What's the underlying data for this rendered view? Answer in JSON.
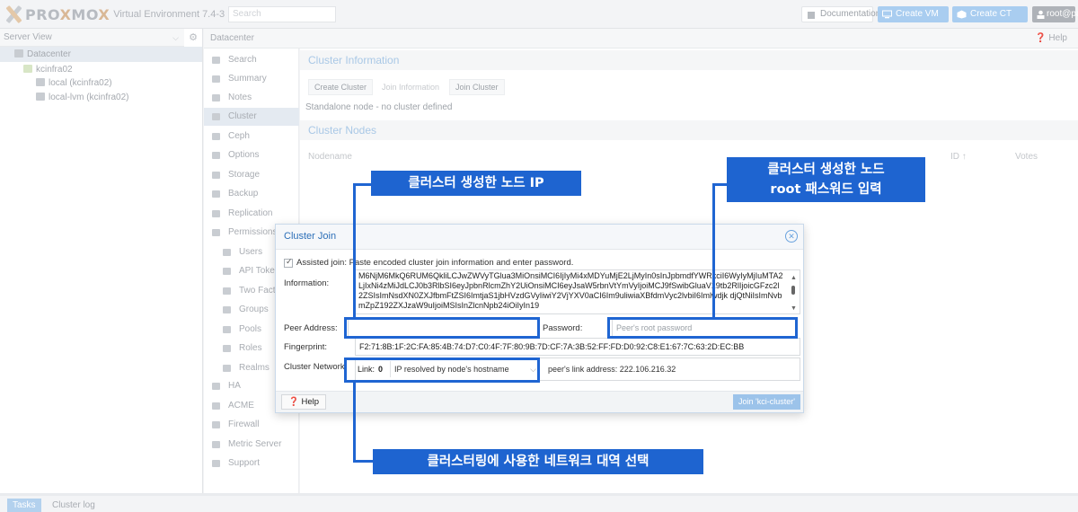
{
  "topbar": {
    "logo_a": "PRO",
    "logo_b": "X",
    "logo_c": "MO",
    "logo_d": "X",
    "subtitle": "Virtual Environment 7.4-3",
    "search_placeholder": "Search",
    "documentation": "Documentation",
    "create_vm": "Create VM",
    "create_ct": "Create CT",
    "user": "root@pam"
  },
  "tree": {
    "view": "Server View",
    "items": [
      {
        "label": "Datacenter"
      },
      {
        "label": "kcinfra02"
      },
      {
        "label": "local (kcinfra02)"
      },
      {
        "label": "local-lvm (kcinfra02)"
      }
    ]
  },
  "breadcrumb": "Datacenter",
  "help_label": "Help",
  "nav": [
    {
      "label": "Search"
    },
    {
      "label": "Summary"
    },
    {
      "label": "Notes"
    },
    {
      "label": "Cluster"
    },
    {
      "label": "Ceph"
    },
    {
      "label": "Options"
    },
    {
      "label": "Storage"
    },
    {
      "label": "Backup"
    },
    {
      "label": "Replication"
    },
    {
      "label": "Permissions"
    },
    {
      "label": "Users"
    },
    {
      "label": "API Tokens"
    },
    {
      "label": "Two Factor"
    },
    {
      "label": "Groups"
    },
    {
      "label": "Pools"
    },
    {
      "label": "Roles"
    },
    {
      "label": "Realms"
    },
    {
      "label": "HA"
    },
    {
      "label": "ACME"
    },
    {
      "label": "Firewall"
    },
    {
      "label": "Metric Server"
    },
    {
      "label": "Support"
    }
  ],
  "cluster": {
    "info_title": "Cluster Information",
    "create_btn": "Create Cluster",
    "join_info_btn": "Join Information",
    "join_btn": "Join Cluster",
    "standalone": "Standalone node - no cluster defined",
    "nodes_title": "Cluster Nodes",
    "col_nodename": "Nodename",
    "col_id": "ID ↑",
    "col_votes": "Votes"
  },
  "dialog": {
    "title": "Cluster Join",
    "assisted": "Assisted join: Paste encoded cluster join information and enter password.",
    "info_label": "Information:",
    "info_value": "M6NjM6MkQ6RUM6QkliLCJwZWVyTGlua3MiOnsiMCI6IjIyMi4xMDYuMjE2LjMyIn0sInJpbmdfYWRkciI6WyIyMjIuMTA2LjIxNi4zMiJdLCJ0b3RlbSI6eyJpbnRlcmZhY2UiOnsiMCI6eyJsaW5rbnVtYmVyIjoiMCJ9fSwibGluaV19tb2RlIjoicGFzc2l2ZSIsImNsdXN0ZXJfbmFtZSI6ImtjaS1jbHVzdGVyIiwiY2VjYXV0aCI6Im9uliwiaXBfdmVyc2lvbiI6Imlwdjk",
    "info_value2": "djQtNiIsImNvbmZpZ192ZXJzaW9uIjoiMSIsInZlcnNpb24iOiIyIn19",
    "peer_label": "Peer Address:",
    "peer_value": "",
    "password_label": "Password:",
    "password_placeholder": "Peer's root password",
    "fingerprint_label": "Fingerprint:",
    "fingerprint": "F2:71:8B:1F:2C:FA:85:4B:74:D7:C0:4F:7F:80:9B:7D:CF:7A:3B:52:FF:FD:D0:92:C8:E1:67:7C:63:2D:EC:BB",
    "network_label": "Cluster Network:",
    "link_label": "Link:",
    "link_num": "0",
    "link_select": "IP resolved by node's hostname",
    "peer_link": "peer's link address: 222.106.216.32",
    "help_btn": "Help",
    "join_btn": "Join 'kci-cluster'"
  },
  "annotations": {
    "peer_ip": "클러스터 생성한 노드 IP",
    "root_pw_1": "클러스터 생성한 노드",
    "root_pw_2": "root 패스워드 입력",
    "network": "클러스터링에 사용한 네트워크 대역 선택"
  },
  "bottom": {
    "tasks": "Tasks",
    "cluster_log": "Cluster log"
  },
  "colors": {
    "annotation_blue": "#1e64d0",
    "dialog_title": "#2c6fb8",
    "faded_blue": "#a9cdf0"
  }
}
